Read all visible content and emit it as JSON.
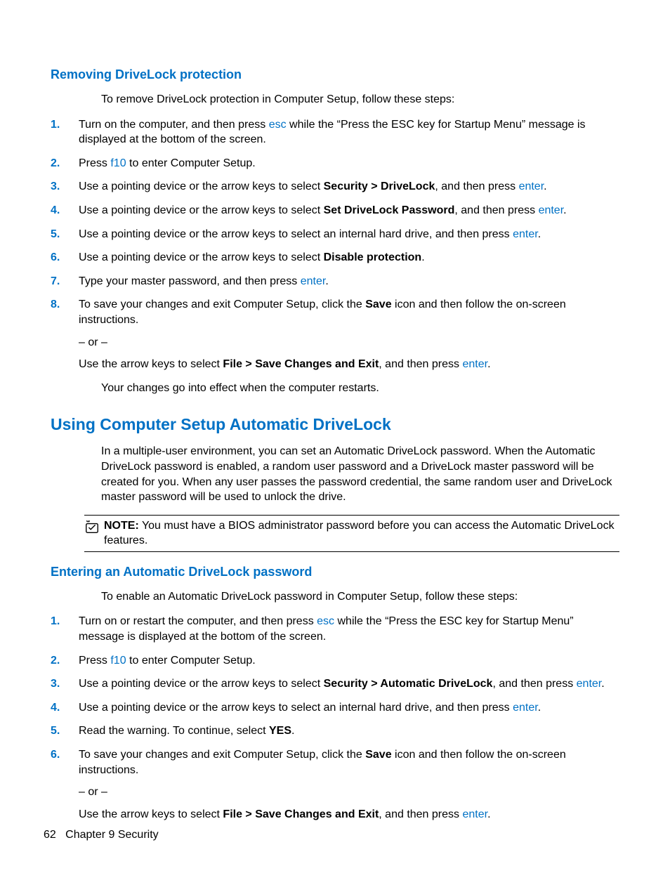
{
  "section1": {
    "heading": "Removing DriveLock protection",
    "intro": "To remove DriveLock protection in Computer Setup, follow these steps:",
    "steps": [
      {
        "num": "1.",
        "parts": [
          {
            "t": "Turn on the computer, and then press "
          },
          {
            "t": "esc",
            "cls": "keylink"
          },
          {
            "t": " while the “Press the ESC key for Startup Menu” message is displayed at the bottom of the screen."
          }
        ]
      },
      {
        "num": "2.",
        "parts": [
          {
            "t": "Press "
          },
          {
            "t": "f10",
            "cls": "keylink"
          },
          {
            "t": " to enter Computer Setup."
          }
        ]
      },
      {
        "num": "3.",
        "parts": [
          {
            "t": "Use a pointing device or the arrow keys to select "
          },
          {
            "t": "Security > DriveLock",
            "bold": true
          },
          {
            "t": ", and then press "
          },
          {
            "t": "enter",
            "cls": "keylink"
          },
          {
            "t": "."
          }
        ]
      },
      {
        "num": "4.",
        "parts": [
          {
            "t": "Use a pointing device or the arrow keys to select "
          },
          {
            "t": "Set DriveLock Password",
            "bold": true
          },
          {
            "t": ", and then press "
          },
          {
            "t": "enter",
            "cls": "keylink"
          },
          {
            "t": "."
          }
        ]
      },
      {
        "num": "5.",
        "parts": [
          {
            "t": "Use a pointing device or the arrow keys to select an internal hard drive, and then press "
          },
          {
            "t": "enter",
            "cls": "keylink"
          },
          {
            "t": "."
          }
        ]
      },
      {
        "num": "6.",
        "parts": [
          {
            "t": "Use a pointing device or the arrow keys to select "
          },
          {
            "t": "Disable protection",
            "bold": true
          },
          {
            "t": "."
          }
        ]
      },
      {
        "num": "7.",
        "parts": [
          {
            "t": "Type your master password, and then press "
          },
          {
            "t": "enter",
            "cls": "keylink"
          },
          {
            "t": "."
          }
        ]
      },
      {
        "num": "8.",
        "paras": [
          [
            {
              "t": "To save your changes and exit Computer Setup, click the "
            },
            {
              "t": "Save",
              "bold": true
            },
            {
              "t": " icon and then follow the on-screen instructions."
            }
          ],
          [
            {
              "t": "– or –"
            }
          ],
          [
            {
              "t": "Use the arrow keys to select "
            },
            {
              "t": "File > Save Changes and Exit",
              "bold": true
            },
            {
              "t": ", and then press "
            },
            {
              "t": "enter",
              "cls": "keylink"
            },
            {
              "t": "."
            }
          ]
        ]
      }
    ],
    "outro": "Your changes go into effect when the computer restarts."
  },
  "section2": {
    "heading": "Using Computer Setup Automatic DriveLock",
    "para": "In a multiple-user environment, you can set an Automatic DriveLock password. When the Automatic DriveLock password is enabled, a random user password and a DriveLock master password will be created for you. When any user passes the password credential, the same random user and DriveLock master password will be used to unlock the drive.",
    "note_label": "NOTE:",
    "note_text": "   You must have a BIOS administrator password before you can access the Automatic DriveLock features."
  },
  "section3": {
    "heading": "Entering an Automatic DriveLock password",
    "intro": "To enable an Automatic DriveLock password in Computer Setup, follow these steps:",
    "steps": [
      {
        "num": "1.",
        "parts": [
          {
            "t": "Turn on or restart the computer, and then press "
          },
          {
            "t": "esc",
            "cls": "keylink"
          },
          {
            "t": " while the “Press the ESC key for Startup Menu” message is displayed at the bottom of the screen."
          }
        ]
      },
      {
        "num": "2.",
        "parts": [
          {
            "t": "Press "
          },
          {
            "t": "f10",
            "cls": "keylink"
          },
          {
            "t": " to enter Computer Setup."
          }
        ]
      },
      {
        "num": "3.",
        "parts": [
          {
            "t": "Use a pointing device or the arrow keys to select "
          },
          {
            "t": "Security > Automatic DriveLock",
            "bold": true
          },
          {
            "t": ", and then press "
          },
          {
            "t": "enter",
            "cls": "keylink"
          },
          {
            "t": "."
          }
        ]
      },
      {
        "num": "4.",
        "parts": [
          {
            "t": "Use a pointing device or the arrow keys to select an internal hard drive, and then press "
          },
          {
            "t": "enter",
            "cls": "keylink"
          },
          {
            "t": "."
          }
        ]
      },
      {
        "num": "5.",
        "parts": [
          {
            "t": "Read the warning. To continue, select "
          },
          {
            "t": "YES",
            "bold": true
          },
          {
            "t": "."
          }
        ]
      },
      {
        "num": "6.",
        "paras": [
          [
            {
              "t": "To save your changes and exit Computer Setup, click the "
            },
            {
              "t": "Save",
              "bold": true
            },
            {
              "t": " icon and then follow the on-screen instructions."
            }
          ],
          [
            {
              "t": "– or –"
            }
          ],
          [
            {
              "t": "Use the arrow keys to select "
            },
            {
              "t": "File > Save Changes and Exit",
              "bold": true
            },
            {
              "t": ", and then press "
            },
            {
              "t": "enter",
              "cls": "keylink"
            },
            {
              "t": "."
            }
          ]
        ]
      }
    ]
  },
  "footer": {
    "page_num": "62",
    "chapter": "Chapter 9   Security"
  }
}
